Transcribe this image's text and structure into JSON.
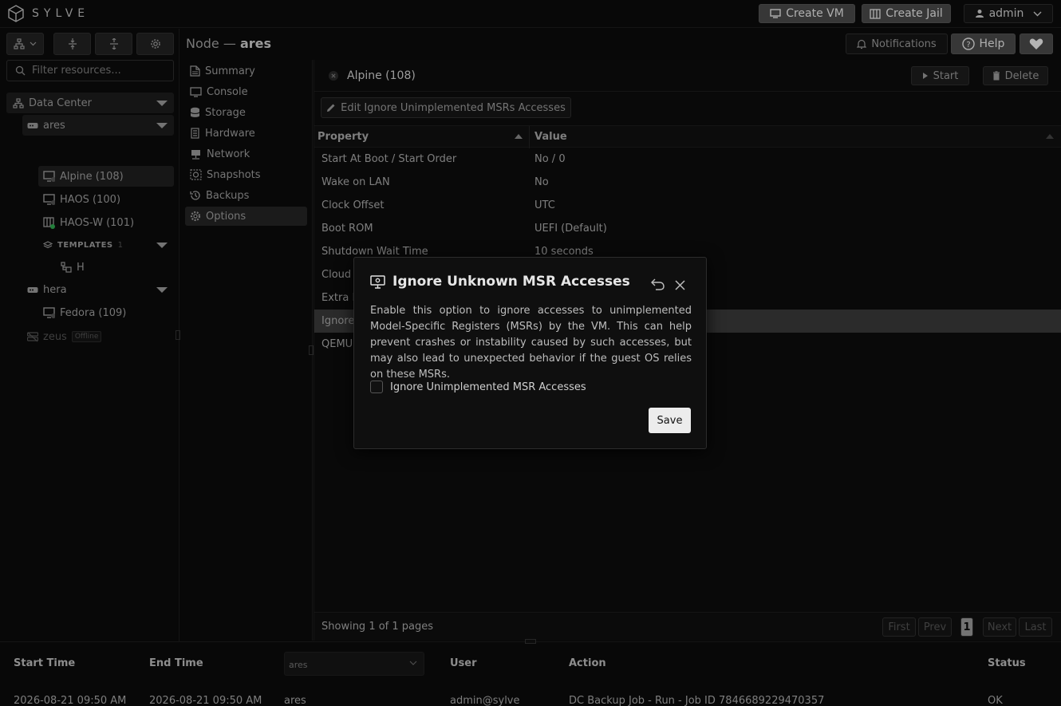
{
  "app": {
    "brand": "SYLVE"
  },
  "topbar": {
    "create_vm": "Create VM",
    "create_jail": "Create Jail",
    "user": "admin",
    "notifications": "Notifications",
    "help": "Help"
  },
  "sidebar": {
    "filter_placeholder": "Filter resources...",
    "tree": {
      "datacenter": "Data Center",
      "ares": "ares",
      "alpine": "Alpine (108)",
      "haos": "HAOS (100)",
      "haos_w": "HAOS-W (101)",
      "templates": "TEMPLATES",
      "templates_count": "1",
      "template_h": "H",
      "hera": "hera",
      "fedora": "Fedora (109)",
      "zeus": "zeus",
      "zeus_status": "Offline"
    }
  },
  "node_header": {
    "prefix": "Node —",
    "name": "ares"
  },
  "menu": {
    "items": [
      {
        "label": "Summary"
      },
      {
        "label": "Console"
      },
      {
        "label": "Storage"
      },
      {
        "label": "Hardware"
      },
      {
        "label": "Network"
      },
      {
        "label": "Snapshots"
      },
      {
        "label": "Backups"
      },
      {
        "label": "Options"
      }
    ]
  },
  "main": {
    "tab_label": "Alpine (108)",
    "start": "Start",
    "delete": "Delete",
    "edit_button": "Edit Ignore Unimplemented MSRs Accesses",
    "col_property": "Property",
    "col_value": "Value",
    "rows": [
      {
        "property": "Start At Boot / Start Order",
        "value": "No / 0"
      },
      {
        "property": "Wake on LAN",
        "value": "No"
      },
      {
        "property": "Clock Offset",
        "value": "UTC"
      },
      {
        "property": "Boot ROM",
        "value": "UEFI (Default)"
      },
      {
        "property": "Shutdown Wait Time",
        "value": "10 seconds"
      },
      {
        "property": "Cloud",
        "value": ""
      },
      {
        "property": "Extra B",
        "value": ""
      },
      {
        "property": "Ignore",
        "value": ""
      },
      {
        "property": "QEMU",
        "value": ""
      }
    ],
    "pagination": {
      "summary": "Showing 1 of 1 pages",
      "first": "First",
      "prev": "Prev",
      "current": "1",
      "next": "Next",
      "last": "Last"
    }
  },
  "bottom": {
    "headers": {
      "start_time": "Start Time",
      "end_time": "End Time",
      "node_select": "ares",
      "user": "User",
      "action": "Action",
      "status": "Status"
    },
    "row": {
      "start_time": "2026-08-21 09:50 AM",
      "end_time": "2026-08-21 09:50 AM",
      "node": "ares",
      "user": "admin@sylve",
      "action": "DC Backup Job - Run - Job ID 7846689229470357",
      "status": "OK"
    }
  },
  "modal": {
    "title": "Ignore Unknown MSR Accesses",
    "description": "Enable this option to ignore accesses to unimplemented Model-Specific Registers (MSRs) by the VM. This can help prevent crashes or instability caused by such accesses, but may also lead to unexpected behavior if the guest OS relies on these MSRs.",
    "checkbox_label": "Ignore Unimplemented MSR Accesses",
    "save": "Save"
  }
}
